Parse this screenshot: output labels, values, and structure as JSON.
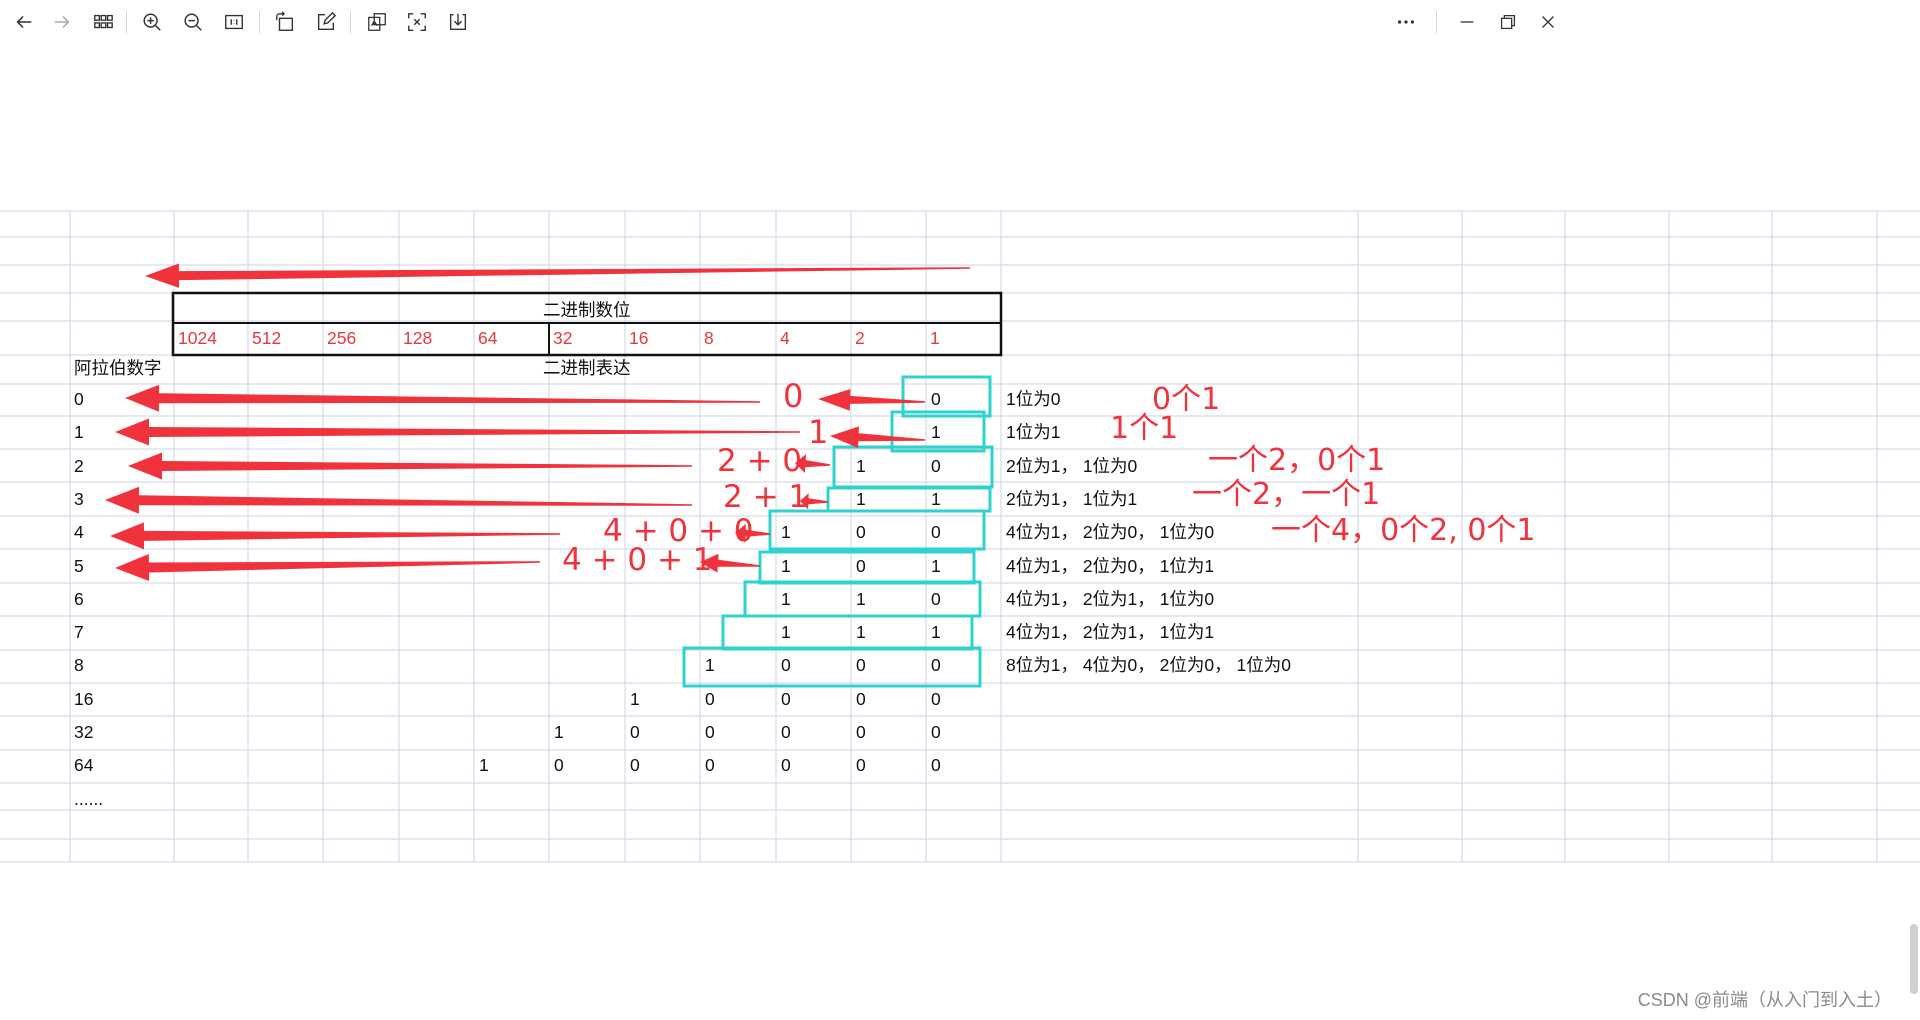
{
  "toolbar": {
    "icons": [
      "back-arrow-icon",
      "forward-arrow-icon",
      "grid-view-icon",
      "zoom-in-icon",
      "zoom-out-icon",
      "fit-page-icon",
      "rotate-icon",
      "edit-icon",
      "ocr-translate-icon",
      "screenshot-icon",
      "download-icon",
      "more-options-icon",
      "minimize-icon",
      "restore-icon",
      "close-icon"
    ]
  },
  "sheet": {
    "header_title": "二进制数位",
    "bit_values": [
      "1024",
      "512",
      "256",
      "128",
      "64",
      "32",
      "16",
      "8",
      "4",
      "2",
      "1"
    ],
    "col_label_arabic": "阿拉伯数字",
    "col_label_binary": "二进制表达",
    "rows": [
      {
        "num": "0",
        "bits": [
          "0"
        ],
        "desc": "1位为0"
      },
      {
        "num": "1",
        "bits": [
          "1"
        ],
        "desc": "1位为1"
      },
      {
        "num": "2",
        "bits": [
          "1",
          "0"
        ],
        "desc": "2位为1， 1位为0"
      },
      {
        "num": "3",
        "bits": [
          "1",
          "1"
        ],
        "desc": "2位为1， 1位为1"
      },
      {
        "num": "4",
        "bits": [
          "1",
          "0",
          "0"
        ],
        "desc": "4位为1， 2位为0， 1位为0"
      },
      {
        "num": "5",
        "bits": [
          "1",
          "0",
          "1"
        ],
        "desc": "4位为1， 2位为0， 1位为1"
      },
      {
        "num": "6",
        "bits": [
          "1",
          "1",
          "0"
        ],
        "desc": "4位为1， 2位为1， 1位为0"
      },
      {
        "num": "7",
        "bits": [
          "1",
          "1",
          "1"
        ],
        "desc": "4位为1， 2位为1， 1位为1"
      },
      {
        "num": "8",
        "bits": [
          "1",
          "0",
          "0",
          "0"
        ],
        "desc": "8位为1， 4位为0， 2位为0， 1位为0"
      },
      {
        "num": "16",
        "bits": [
          "1",
          "0",
          "0",
          "0",
          "0"
        ],
        "desc": ""
      },
      {
        "num": "32",
        "bits": [
          "1",
          "0",
          "0",
          "0",
          "0",
          "0"
        ],
        "desc": ""
      },
      {
        "num": "64",
        "bits": [
          "1",
          "0",
          "0",
          "0",
          "0",
          "0",
          "0"
        ],
        "desc": ""
      },
      {
        "num": "......",
        "bits": [],
        "desc": ""
      }
    ]
  },
  "annotations": {
    "sum_labels": [
      "0",
      "1",
      "2 + 0",
      "2 + 1",
      "4 + 0 + 0",
      "4 + 0 + 1"
    ],
    "count_labels": [
      "0个1",
      "1个1",
      "一个2，0个1",
      "一个2，一个1",
      "一个4，0个2, 0个1"
    ]
  },
  "watermark": "CSDN @前端（从入门到入土）",
  "colors": {
    "grid": "#cfd3e6",
    "accent_red": "#f0323c",
    "highlight_box": "#2ed3d0",
    "header_border": "#111111",
    "red_text": "#e8383d"
  }
}
